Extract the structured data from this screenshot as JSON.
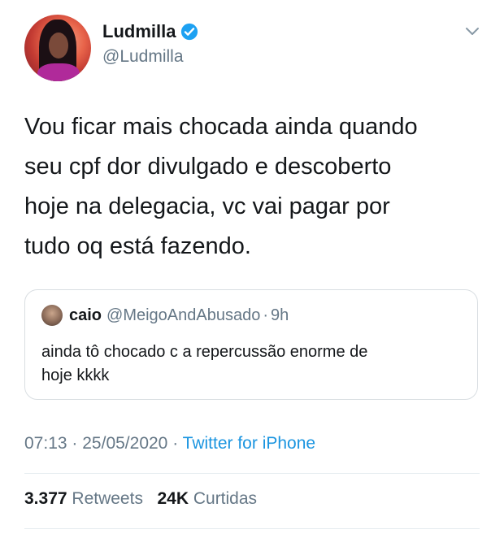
{
  "author": {
    "display_name": "Ludmilla",
    "handle": "@Ludmilla",
    "avatar_icon": "profile-photo",
    "verified_icon": "verified-badge-icon",
    "verified_color": "#1da1f2"
  },
  "tweet": {
    "text": "Vou ficar mais chocada ainda quando\nseu cpf dor divulgado e descoberto\nhoje na delegacia, vc vai pagar por\ntudo oq está fazendo."
  },
  "quoted_tweet": {
    "name": "caio",
    "handle": "@MeigoAndAbusado",
    "separator": "·",
    "time": "9h",
    "text": "ainda tô chocado c a repercussão enorme de\nhoje kkkk"
  },
  "meta": {
    "time": "07:13",
    "sep1": "·",
    "date": "25/05/2020",
    "sep2": "·",
    "source": "Twitter for iPhone",
    "source_color": "#1b95e0"
  },
  "stats": {
    "retweets_count": "3.377",
    "retweets_label": "Retweets",
    "likes_count": "24K",
    "likes_label": "Curtidas"
  },
  "colors": {
    "text": "#14171a",
    "secondary": "#657786",
    "border": "#d9dee2"
  }
}
